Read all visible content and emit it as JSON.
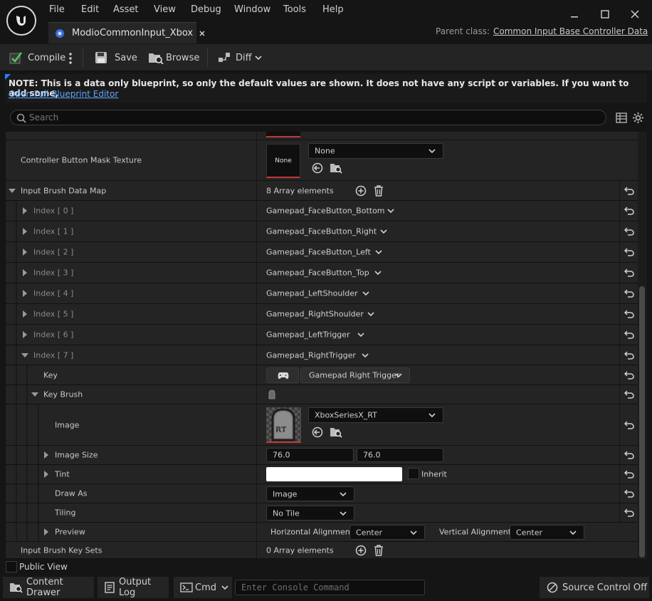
{
  "menu": [
    "File",
    "Edit",
    "Asset",
    "View",
    "Debug",
    "Window",
    "Tools",
    "Help"
  ],
  "tab": {
    "title": "ModioCommonInput_Xbox"
  },
  "parent_class": {
    "label": "Parent class:",
    "value": "Common Input Base Controller Data"
  },
  "toolbar": {
    "compile": "Compile",
    "save": "Save",
    "browse": "Browse",
    "diff": "Diff"
  },
  "note": {
    "text": "NOTE: This is a data only blueprint, so only the default values are shown.  It does not have any script or variables.  If you want to add some,",
    "link": "Open Full Blueprint Editor"
  },
  "search": {
    "placeholder": "Search"
  },
  "details": {
    "mask_texture": {
      "label": "Controller Button Mask Texture",
      "thumb": "None",
      "value": "None"
    },
    "brush_map": {
      "label": "Input Brush Data Map",
      "count": "8 Array elements"
    },
    "indices": [
      {
        "label": "Index [ 0 ]",
        "value": "Gamepad_FaceButton_Bottom"
      },
      {
        "label": "Index [ 1 ]",
        "value": "Gamepad_FaceButton_Right"
      },
      {
        "label": "Index [ 2 ]",
        "value": "Gamepad_FaceButton_Left"
      },
      {
        "label": "Index [ 3 ]",
        "value": "Gamepad_FaceButton_Top"
      },
      {
        "label": "Index [ 4 ]",
        "value": "Gamepad_LeftShoulder"
      },
      {
        "label": "Index [ 5 ]",
        "value": "Gamepad_RightShoulder"
      },
      {
        "label": "Index [ 6 ]",
        "value": "Gamepad_LeftTrigger"
      },
      {
        "label": "Index [ 7 ]",
        "value": "Gamepad_RightTrigger"
      }
    ],
    "key": {
      "label": "Key",
      "value": "Gamepad Right Trigger"
    },
    "key_brush": {
      "label": "Key Brush"
    },
    "image": {
      "label": "Image",
      "value": "XboxSeriesX_RT",
      "thumb_text": "RT"
    },
    "image_size": {
      "label": "Image Size",
      "x": "76.0",
      "y": "76.0"
    },
    "tint": {
      "label": "Tint",
      "inherit": "Inherit"
    },
    "draw_as": {
      "label": "Draw As",
      "value": "Image"
    },
    "tiling": {
      "label": "Tiling",
      "value": "No Tile"
    },
    "preview": {
      "label": "Preview",
      "h_label": "Horizontal Alignment",
      "h_value": "Center",
      "v_label": "Vertical Alignment",
      "v_value": "Center"
    },
    "key_sets": {
      "label": "Input Brush Key Sets",
      "count": "0 Array elements"
    }
  },
  "public_view": {
    "label": "Public View"
  },
  "statusbar": {
    "content_drawer": "Content Drawer",
    "output_log": "Output Log",
    "cmd": "Cmd",
    "console_placeholder": "Enter Console Command",
    "source_control": "Source Control Off"
  },
  "colors": {
    "accent": "#2a7fff",
    "link": "#5fa8ff",
    "thumb_underline": "#c0393b"
  }
}
